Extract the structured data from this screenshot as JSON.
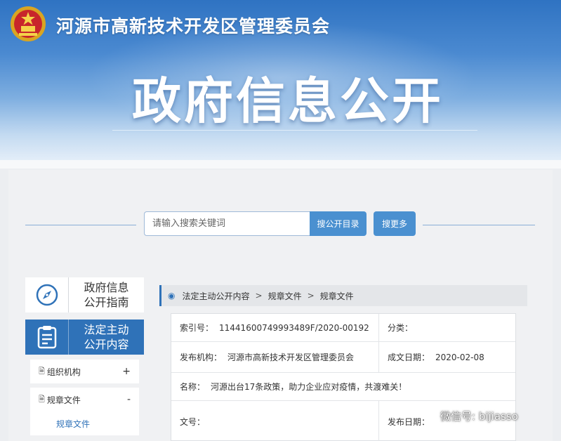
{
  "header": {
    "org_name": "河源市高新技术开发区管理委员会",
    "main_title": "政府信息公开",
    "emblem_icon": "national-emblem-icon"
  },
  "search": {
    "placeholder": "请输入搜索关键词",
    "search_button": "搜公开目录",
    "more_button": "搜更多"
  },
  "sidebar": {
    "guide": {
      "label_line1": "政府信息",
      "label_line2": "公开指南",
      "icon": "compass-icon"
    },
    "active": {
      "label_line1": "法定主动",
      "label_line2": "公开内容",
      "icon": "clipboard-icon"
    },
    "items": [
      {
        "label": "组织机构",
        "toggle": "+"
      },
      {
        "label": "规章文件",
        "toggle": "-"
      }
    ],
    "sub_item": "规章文件"
  },
  "breadcrumb": {
    "items": [
      "法定主动公开内容",
      "规章文件",
      "规章文件"
    ],
    "separator": ">"
  },
  "info": {
    "index_label": "索引号：",
    "index_value": "11441600749993489F/2020-00192",
    "category_label": "分类：",
    "category_value": "",
    "publisher_label": "发布机构：",
    "publisher_value": "河源市高新技术开发区管理委员会",
    "created_label": "成文日期：",
    "created_value": "2020-02-08",
    "name_label": "名称：",
    "name_value": "河源出台17条政策，助力企业应对疫情，共渡难关！",
    "doc_no_label": "文号：",
    "doc_no_value": "",
    "publish_date_label": "发布日期：",
    "publish_date_value": ""
  },
  "watermark": {
    "text": "微信号: bijiasso",
    "icon": "wechat-icon"
  },
  "colors": {
    "primary": "#2f72b8",
    "button": "#4a90d0",
    "banner_top": "#2f73c2"
  }
}
